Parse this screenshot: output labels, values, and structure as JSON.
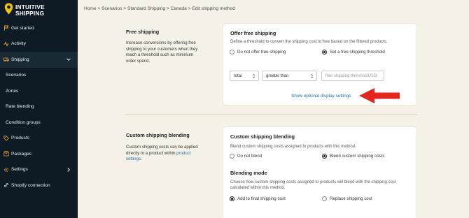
{
  "brand": {
    "line1": "INTUITIVE",
    "line2": "SHIPPING"
  },
  "colors": {
    "sidebar_bg": "#0e1b24",
    "page_bg": "#f6f1e7",
    "accent_yellow": "#f1c40f",
    "link_blue": "#1c6f9b",
    "annotation_red": "#e5261d"
  },
  "sidebar": {
    "items": [
      {
        "label": "Get started",
        "icon": "flag-icon"
      },
      {
        "label": "Activity",
        "icon": "activity-icon"
      },
      {
        "label": "Shipping",
        "icon": "truck-icon"
      },
      {
        "label": "Scenarios"
      },
      {
        "label": "Zones"
      },
      {
        "label": "Rate blending"
      },
      {
        "label": "Condition groups"
      },
      {
        "label": "Products",
        "icon": "tag-icon"
      },
      {
        "label": "Packages",
        "icon": "package-icon"
      },
      {
        "label": "Settings",
        "icon": "gear-icon"
      },
      {
        "label": "Shopify connection",
        "icon": "link-icon"
      }
    ]
  },
  "breadcrumb": "Home > Scenarios > Standard Shipping > Canada > Edit shipping method",
  "free_shipping": {
    "section_title": "Free shipping",
    "section_desc": [
      "Increase conversions by offering free",
      "shipping to your customers when they",
      "reach a threshold such as minimum",
      "order spend."
    ],
    "card_title": "Offer free shipping",
    "card_desc": "Define a threshold to convert the shipping cost to free based on the filtered products.",
    "option_off": "Do not offer free shipping",
    "option_threshold": "Set a free shipping threshold",
    "selected": "threshold",
    "filter_field": "total",
    "filter_operator": "greater than",
    "threshold_placeholder": "free shipping threshold",
    "currency": "USD",
    "optional_link": "Show optional display settings"
  },
  "blending": {
    "section_title": "Custom shipping blending",
    "section_desc_1": "Custom shipping costs can be applied",
    "section_desc_2": "directly to a product within",
    "section_desc_link": "product",
    "section_desc_link2": "settings",
    "section_desc_end": ".",
    "card_title": "Custom shipping blending",
    "card_desc": "Blend custom shipping costs assigned to products with this method.",
    "option_no": "Do not blend",
    "option_yes": "Blend custom shipping costs",
    "selected": "blend",
    "mode_title": "Blending mode",
    "mode_desc": [
      "Choose how custom shipping costs assigned to products will blend with the shipping cost",
      "calculated within this method."
    ],
    "mode_add": "Add to final shipping cost",
    "mode_replace": "Replace shipping cost",
    "mode_selected": "add"
  }
}
